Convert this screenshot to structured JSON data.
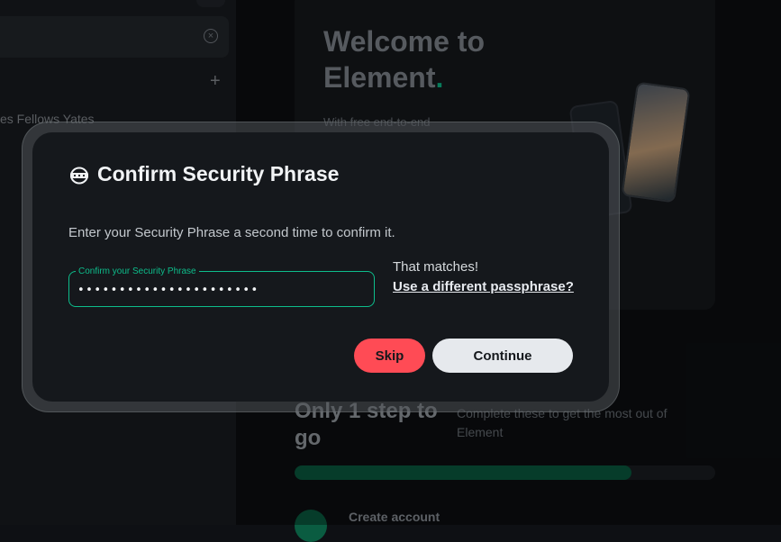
{
  "background": {
    "left_panel": {
      "room_name": "es Fellows Yates",
      "search_clear_icon": "close-circle-icon",
      "add_icon": "plus-icon"
    },
    "welcome": {
      "title_line1": "Welcome to",
      "title_line2": "Element",
      "title_dot": ".",
      "subtitle": "With free end-to-end"
    },
    "onboarding": {
      "title": "Only 1 step to go",
      "description": "Complete these to get the most out of Element",
      "progress_fraction": 0.8,
      "step_label": "Create account"
    }
  },
  "dialog": {
    "icon": "secure-backup-icon",
    "title": "Confirm Security Phrase",
    "description": "Enter your Security Phrase a second time to confirm it.",
    "field": {
      "label": "Confirm your Security Phrase",
      "value": "••••••••••••••••••••••"
    },
    "match_text": "That matches!",
    "different_link": "Use a different passphrase?",
    "skip_label": "Skip",
    "continue_label": "Continue"
  },
  "colors": {
    "accent": "#0dbd8b",
    "danger": "#ff4b55",
    "dialog_bg": "#15181c"
  }
}
